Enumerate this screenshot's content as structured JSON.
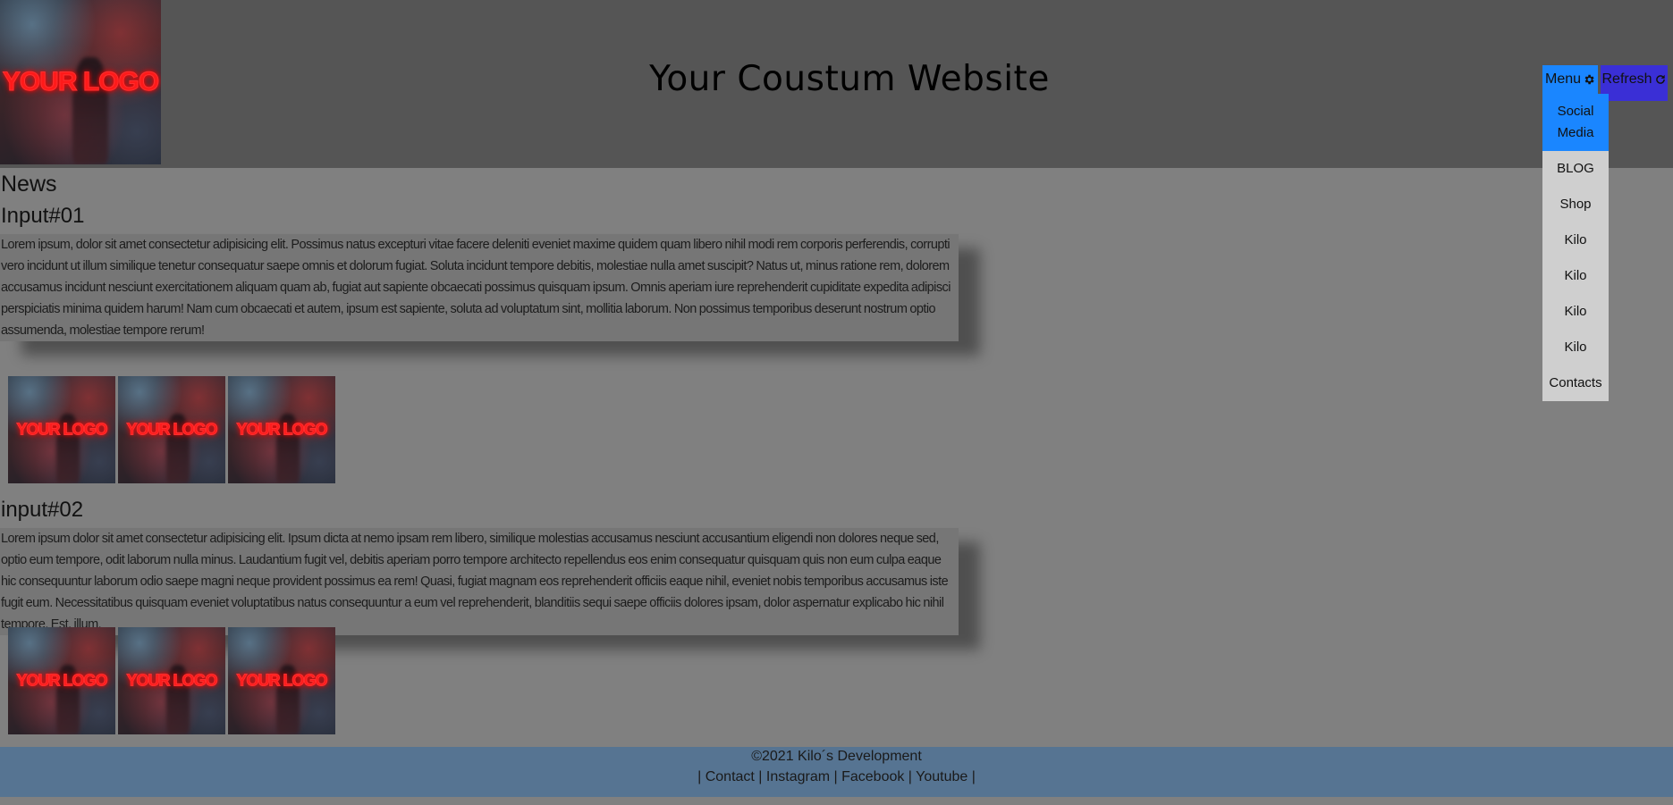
{
  "header": {
    "logo_text": "YOUR LOGO",
    "title": "Your Coustum Website"
  },
  "controls": {
    "menu_label": "Menu",
    "menu_icon": "gear-icon",
    "refresh_label": "Refresh",
    "refresh_icon": "refresh-icon",
    "menu_color": "#1a86ff",
    "refresh_color": "#3a2fd6"
  },
  "menu": {
    "items": [
      {
        "label": "Social Media",
        "active": true
      },
      {
        "label": "BLOG"
      },
      {
        "label": "Shop"
      },
      {
        "label": "Kilo"
      },
      {
        "label": "Kilo"
      },
      {
        "label": "Kilo"
      },
      {
        "label": "Kilo"
      },
      {
        "label": "Contacts"
      }
    ]
  },
  "news": {
    "heading": "News",
    "articles": [
      {
        "title": "Input#01",
        "text": "Lorem ipsum, dolor sit amet consectetur adipisicing elit. Possimus natus excepturi vitae facere deleniti eveniet maxime quidem quam libero nihil modi rem corporis perferendis, corrupti vero incidunt ut illum similique tenetur consequatur saepe omnis et dolorum fugiat. Soluta incidunt tempore debitis, molestiae nulla amet suscipit? Natus ut, minus ratione rem, dolorem accusamus incidunt nesciunt exercitationem aliquam quam ab, fugiat aut sapiente obcaecati possimus quisquam ipsum. Omnis aperiam iure reprehenderit cupiditate expedita adipisci perspiciatis minima quidem harum! Nam cum obcaecati et autem, ipsum est sapiente, soluta ad voluptatum sint, mollitia laborum. Non possimus temporibus deserunt nostrum optio assumenda, molestiae tempore rerum!",
        "images": [
          "YOUR LOGO",
          "YOUR LOGO",
          "YOUR LOGO"
        ]
      },
      {
        "title": "input#02",
        "text": "Lorem ipsum dolor sit amet consectetur adipisicing elit. Ipsum dicta at nemo ipsam rem libero, similique molestias accusamus nesciunt accusantium eligendi non dolores neque sed, optio eum tempore, odit laborum nulla minus. Laudantium fugit vel, debitis aperiam porro tempore architecto repellendus eos enim consequatur quisquam quis non eum culpa eaque hic consequuntur laborum odio saepe magni neque provident possimus ea rem! Quasi, fugiat magnam eos reprehenderit officiis eaque nihil, eveniet nobis temporibus accusamus iste fugit eum. Necessitatibus quisquam eveniet voluptatibus natus consequuntur a eum vel reprehenderit, blanditiis sequi saepe officiis dolores ipsam, dolor aspernatur explicabo hic nihil tempore. Est, illum.",
        "images": [
          "YOUR LOGO",
          "YOUR LOGO",
          "YOUR LOGO"
        ]
      }
    ]
  },
  "footer": {
    "copyright": "©2021 Kilo´s Development",
    "links": [
      "Contact",
      "Instagram",
      "Facebook",
      "Youtube"
    ],
    "color": "#567492"
  }
}
